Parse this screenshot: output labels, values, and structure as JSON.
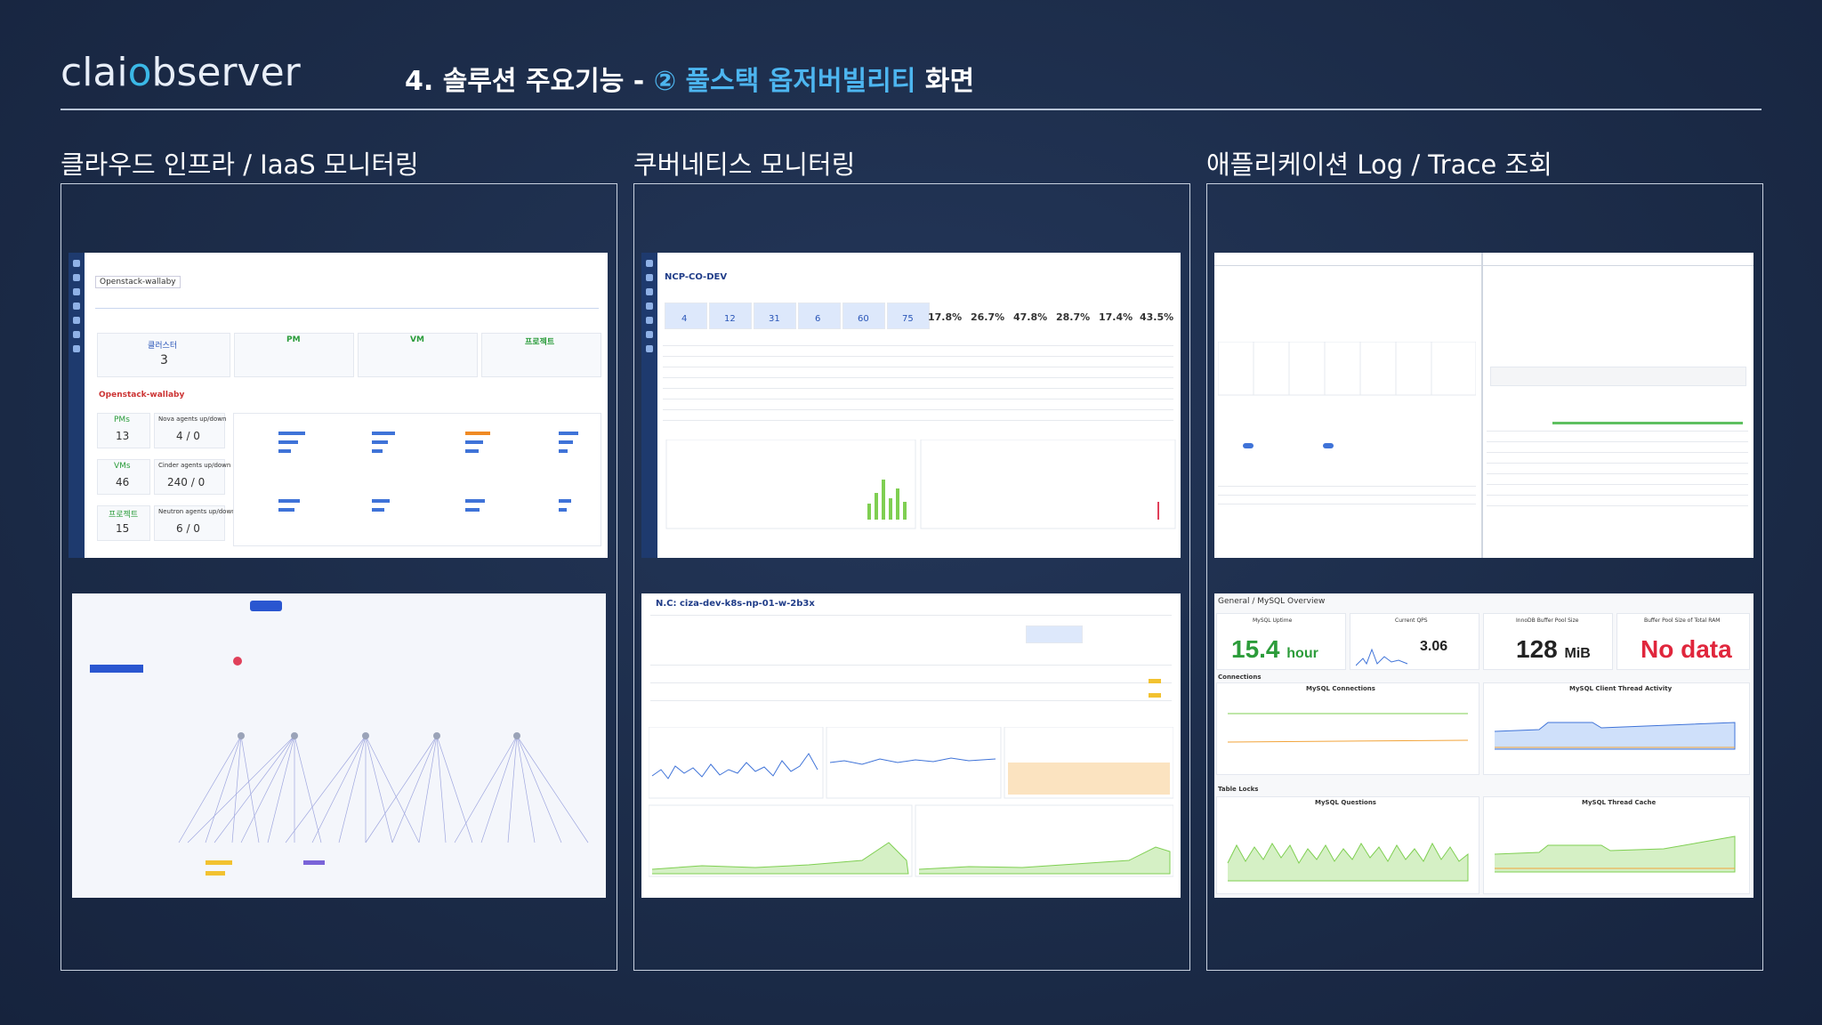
{
  "brand": {
    "logo_part1": "clai",
    "logo_part2": "o",
    "logo_part3": "bserver"
  },
  "header": {
    "title_prefix": "4. 솔루션 주요기능 - ",
    "title_highlight": "② 풀스택 옵저버빌리티",
    "title_suffix": " 화면"
  },
  "sections": [
    {
      "label": "클라우드 인프라 / IaaS 모니터링"
    },
    {
      "label": "쿠버네티스 모니터링"
    },
    {
      "label": "애플리케이션 Log / Trace 조회"
    }
  ],
  "iaas_overview": {
    "tenant": "Openstack-wallaby",
    "group_pm": "PM",
    "group_vm": "VM",
    "group_project": "프로젝트",
    "cluster_label": "클러스터",
    "cluster_count": "3",
    "pms_label": "PMs",
    "pms_value": "13",
    "pms_ratio": "4 / 0",
    "vms_label": "VMs",
    "vms_value": "46",
    "vms_ratio": "240 / 0",
    "projects_label": "프로젝트",
    "projects_value": "15",
    "projects_ratio": "6 / 0",
    "nova_label": "Nova agents up/down",
    "cinder_label": "Cinder agents up/down",
    "neutron_label": "Neutron agents up/down"
  },
  "k8s_overview": {
    "cluster_name": "NCP-CO-DEV",
    "stat_values": [
      "4",
      "12",
      "31",
      "6",
      "60",
      "75"
    ],
    "pct_values": [
      "17.8%",
      "26.7%",
      "47.8%",
      "28.7%",
      "17.4%",
      "43.5%"
    ]
  },
  "k8s_node": {
    "node_name": "N.C: ciza-dev-k8s-np-01-w-2b3x"
  },
  "grafana": {
    "dashboard": "General / MySQL Overview",
    "uptime_label": "MySQL Uptime",
    "uptime_value": "15.4",
    "uptime_unit": "hour",
    "qps_label": "Current QPS",
    "qps_value": "3.06",
    "buffer_label": "InnoDB Buffer Pool Size",
    "buffer_value": "128",
    "buffer_unit": "MiB",
    "ram_label": "Buffer Pool Size of Total RAM",
    "ram_value": "No data",
    "connections_row": "Connections",
    "conn_chart": "MySQL Connections",
    "thread_chart": "MySQL Client Thread Activity",
    "table_locks_row": "Table Locks",
    "questions_chart": "MySQL Questions",
    "thread_cache_chart": "MySQL Thread Cache"
  },
  "colors": {
    "accent": "#4db6f0",
    "background": "#1c2c49",
    "brand_blue": "#3bb8e6",
    "grafana_green": "#73bf69",
    "grafana_red": "#f2495c"
  }
}
